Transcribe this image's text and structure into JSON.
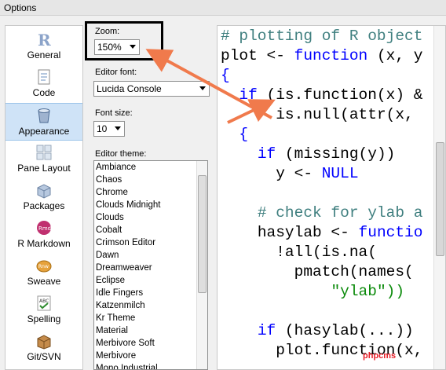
{
  "window": {
    "title": "Options"
  },
  "sidebar": {
    "items": [
      {
        "label": "General",
        "icon": "r-logo-icon"
      },
      {
        "label": "Code",
        "icon": "code-document-icon"
      },
      {
        "label": "Appearance",
        "icon": "appearance-bucket-icon",
        "selected": true
      },
      {
        "label": "Pane Layout",
        "icon": "pane-layout-icon"
      },
      {
        "label": "Packages",
        "icon": "packages-icon"
      },
      {
        "label": "R Markdown",
        "icon": "rmd-icon"
      },
      {
        "label": "Sweave",
        "icon": "sweave-icon"
      },
      {
        "label": "Spelling",
        "icon": "spelling-abc-icon"
      },
      {
        "label": "Git/SVN",
        "icon": "git-box-icon"
      }
    ]
  },
  "appearance": {
    "zoom_label": "Zoom:",
    "zoom_value": "150%",
    "font_label": "Editor font:",
    "font_value": "Lucida Console",
    "font_size_label": "Font size:",
    "font_size_value": "10",
    "theme_label": "Editor theme:",
    "themes": [
      "Ambiance",
      "Chaos",
      "Chrome",
      "Clouds Midnight",
      "Clouds",
      "Cobalt",
      "Crimson Editor",
      "Dawn",
      "Dreamweaver",
      "Eclipse",
      "Idle Fingers",
      "Katzenmilch",
      "Kr Theme",
      "Material",
      "Merbivore Soft",
      "Merbivore",
      "Mono Industrial"
    ]
  },
  "preview": {
    "lines": [
      {
        "indent": "",
        "parts": [
          {
            "t": "# plotting of R object",
            "c": "cm"
          }
        ]
      },
      {
        "indent": "",
        "parts": [
          {
            "t": "plot <- ",
            "c": ""
          },
          {
            "t": "function",
            "c": "kw"
          },
          {
            "t": " (x, y",
            "c": ""
          }
        ]
      },
      {
        "indent": "",
        "parts": [
          {
            "t": "{",
            "c": "kw"
          }
        ]
      },
      {
        "indent": "  ",
        "parts": [
          {
            "t": "if",
            "c": "kw"
          },
          {
            "t": " (is.function(x) &",
            "c": ""
          }
        ]
      },
      {
        "indent": "      ",
        "parts": [
          {
            "t": "is.null(attr(x,",
            "c": ""
          }
        ]
      },
      {
        "indent": "  ",
        "parts": [
          {
            "t": "{",
            "c": "kw"
          }
        ]
      },
      {
        "indent": "    ",
        "parts": [
          {
            "t": "if",
            "c": "kw"
          },
          {
            "t": " (missing(y))",
            "c": ""
          }
        ]
      },
      {
        "indent": "      ",
        "parts": [
          {
            "t": "y <- ",
            "c": ""
          },
          {
            "t": "NULL",
            "c": "kw"
          }
        ]
      },
      {
        "indent": "",
        "parts": [
          {
            "t": "",
            "c": ""
          }
        ]
      },
      {
        "indent": "    ",
        "parts": [
          {
            "t": "# check for ylab a",
            "c": "cm"
          }
        ]
      },
      {
        "indent": "    ",
        "parts": [
          {
            "t": "hasylab <- ",
            "c": ""
          },
          {
            "t": "functio",
            "c": "kw"
          }
        ]
      },
      {
        "indent": "      ",
        "parts": [
          {
            "t": "!all(is.na(",
            "c": ""
          }
        ]
      },
      {
        "indent": "        ",
        "parts": [
          {
            "t": "pmatch(names(",
            "c": ""
          }
        ]
      },
      {
        "indent": "            ",
        "parts": [
          {
            "t": "\"ylab\"))",
            "c": "st"
          }
        ]
      },
      {
        "indent": "",
        "parts": [
          {
            "t": "",
            "c": ""
          }
        ]
      },
      {
        "indent": "    ",
        "parts": [
          {
            "t": "if",
            "c": "kw"
          },
          {
            "t": " (hasylab(...))",
            "c": ""
          }
        ]
      },
      {
        "indent": "      ",
        "parts": [
          {
            "t": "plot.function(x,",
            "c": ""
          }
        ]
      }
    ]
  },
  "watermark": "phpcms",
  "colors": {
    "selected_bg": "#cfe3f7",
    "arrow": "#f07a4c",
    "keyword": "#0000ff",
    "comment": "#3f7f7f"
  }
}
